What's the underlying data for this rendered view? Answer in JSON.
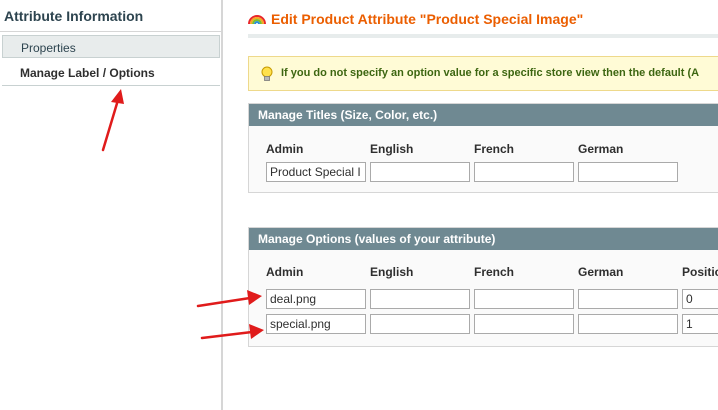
{
  "sidebar": {
    "title": "Attribute Information",
    "tabs": [
      {
        "label": "Properties"
      },
      {
        "label": "Manage Label / Options"
      }
    ]
  },
  "header": {
    "title": "Edit Product Attribute \"Product Special Image\"",
    "icon": "rainbow-icon"
  },
  "notice": {
    "icon": "lightbulb-icon",
    "text": "If you do not specify an option value for a specific store view then the default (A"
  },
  "titles_section": {
    "heading": "Manage Titles (Size, Color, etc.)",
    "columns": [
      "Admin",
      "English",
      "French",
      "German"
    ],
    "values": [
      "Product Special I",
      "",
      "",
      ""
    ]
  },
  "options_section": {
    "heading": "Manage Options (values of your attribute)",
    "columns": [
      "Admin",
      "English",
      "French",
      "German",
      "Positio"
    ],
    "rows": [
      {
        "admin": "deal.png",
        "english": "",
        "french": "",
        "german": "",
        "position": "0"
      },
      {
        "admin": "special.png",
        "english": "",
        "french": "",
        "german": "",
        "position": "1"
      }
    ]
  },
  "colors": {
    "accent_title": "#eb5e00",
    "section_header": "#6f8992",
    "annotation_arrow": "#e01b1b"
  }
}
